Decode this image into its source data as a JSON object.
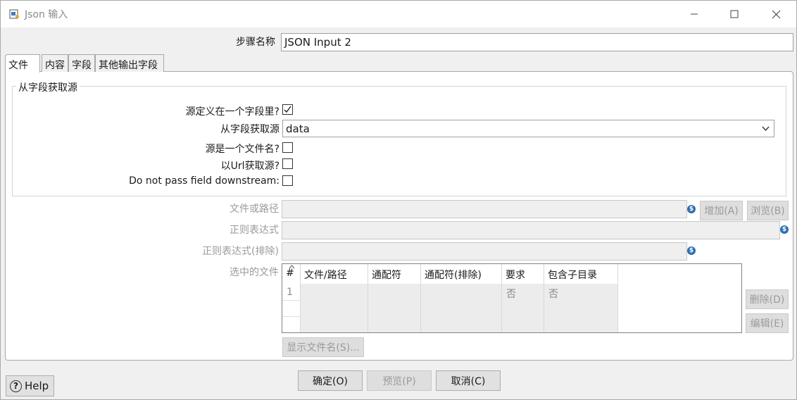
{
  "window": {
    "title": "Json 输入"
  },
  "step": {
    "label": "步骤名称",
    "value": "JSON Input 2"
  },
  "tabs": [
    {
      "label": "文件",
      "active": true
    },
    {
      "label": "内容",
      "active": false
    },
    {
      "label": "字段",
      "active": false
    },
    {
      "label": "其他输出字段",
      "active": false
    }
  ],
  "group": {
    "title": "从字段获取源",
    "source_in_field_label": "源定义在一个字段里?",
    "source_in_field_checked": true,
    "get_source_from_field_label": "从字段获取源",
    "get_source_from_field_value": "data",
    "source_is_filename_label": "源是一个文件名?",
    "source_is_filename_checked": false,
    "read_source_as_url_label": "以Url获取源?",
    "read_source_as_url_checked": false,
    "do_not_pass_label": "Do not pass field downstream:",
    "do_not_pass_checked": false
  },
  "file_section": {
    "file_or_dir_label": "文件或路径",
    "file_or_dir_value": "",
    "add_button": "增加(A)",
    "browse_button": "浏览(B)",
    "regex_label": "正则表达式",
    "regex_value": "",
    "regex_exclude_label": "正则表达式(排除)",
    "regex_exclude_value": "",
    "selected_files_label": "选中的文件",
    "delete_button": "删除(D)",
    "edit_button": "编辑(E)",
    "show_filenames_button": "显示文件名(S)..."
  },
  "table": {
    "columns": [
      "#",
      "文件/路径",
      "通配符",
      "通配符(排除)",
      "要求",
      "包含子目录"
    ],
    "rows": [
      [
        "1",
        "",
        "",
        "",
        "否",
        "否"
      ]
    ]
  },
  "footer": {
    "help": "Help",
    "ok": "确定(O)",
    "preview": "预览(P)",
    "cancel": "取消(C)"
  }
}
